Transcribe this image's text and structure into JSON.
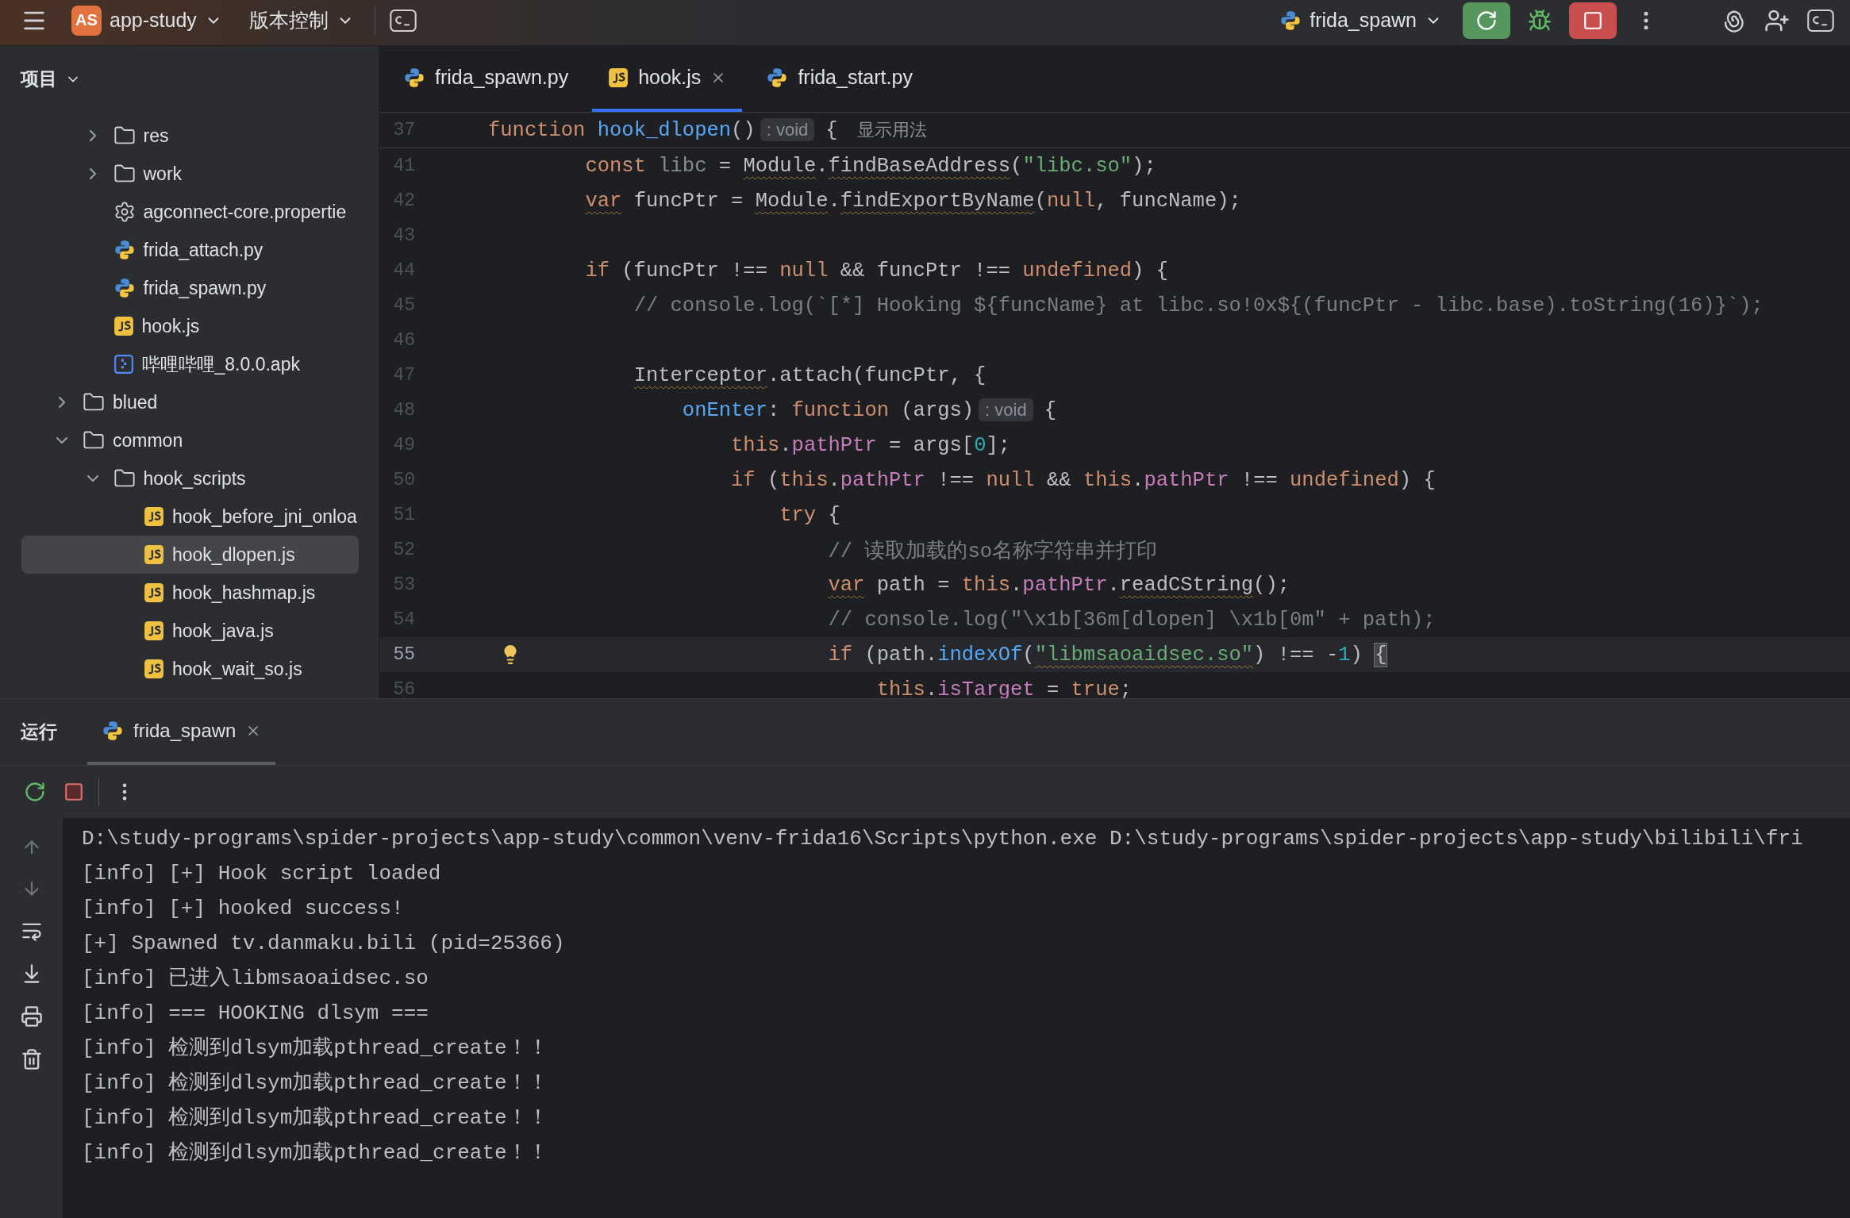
{
  "toolbar": {
    "project_badge": "AS",
    "project": "app-study",
    "vcs": "版本控制",
    "run_config": "frida_spawn"
  },
  "sidebar": {
    "title": "项目",
    "tree": [
      {
        "children": [
          {
            "label": "res",
            "kind": "folder",
            "expanded": false,
            "selected": false
          },
          {
            "label": "work",
            "kind": "folder",
            "expanded": false,
            "selected": false
          },
          {
            "label": "agconnect-core.propertie",
            "kind": "settings",
            "selected": false
          },
          {
            "label": "frida_attach.py",
            "kind": "python",
            "selected": false
          },
          {
            "label": "frida_spawn.py",
            "kind": "python",
            "selected": false
          },
          {
            "label": "hook.js",
            "kind": "js",
            "selected": false
          },
          {
            "label": "哔哩哔哩_8.0.0.apk",
            "kind": "apk",
            "selected": false
          }
        ]
      },
      {
        "label": "blued",
        "kind": "folder",
        "expanded": false,
        "selected": false
      },
      {
        "label": "common",
        "kind": "folder",
        "expanded": true,
        "selected": false,
        "children": [
          {
            "label": "hook_scripts",
            "kind": "folder",
            "expanded": true,
            "selected": false,
            "children": [
              {
                "label": "hook_before_jni_onloa",
                "kind": "js",
                "selected": false
              },
              {
                "label": "hook_dlopen.js",
                "kind": "js",
                "selected": true
              },
              {
                "label": "hook_hashmap.js",
                "kind": "js",
                "selected": false
              },
              {
                "label": "hook_java.js",
                "kind": "js",
                "selected": false
              },
              {
                "label": "hook_wait_so.js",
                "kind": "js",
                "selected": false
              }
            ]
          }
        ]
      }
    ]
  },
  "editor_tabs": [
    {
      "label": "frida_spawn.py",
      "kind": "python",
      "selected": false
    },
    {
      "label": "hook.js",
      "kind": "js",
      "selected": true
    },
    {
      "label": "frida_start.py",
      "kind": "python",
      "selected": false
    }
  ],
  "sticky_line": {
    "n": "37",
    "tokens": [
      {
        "text": "function ",
        "kind": "kw"
      },
      {
        "text": "hook_dlopen",
        "kind": "fn"
      },
      {
        "text": "()",
        "kind": "plain"
      },
      {
        "text": ": void",
        "kind": "hint"
      },
      {
        "text": "{",
        "kind": "plain"
      },
      {
        "text": "显示用法",
        "kind": "usage"
      }
    ]
  },
  "code": [
    {
      "n": "41",
      "current": false,
      "tokens": [
        {
          "text": "        const ",
          "kind": "kw"
        },
        {
          "text": "libc",
          "kind": "dim"
        },
        {
          "text": " = ",
          "kind": "plain"
        },
        {
          "text": "Module",
          "kind": "warn"
        },
        {
          "text": ".",
          "kind": "plain"
        },
        {
          "text": "findBaseAddress",
          "kind": "warn"
        },
        {
          "text": "(",
          "kind": "plain"
        },
        {
          "text": "\"libc.so\"",
          "kind": "str"
        },
        {
          "text": ");",
          "kind": "plain"
        }
      ]
    },
    {
      "n": "42",
      "current": false,
      "tokens": [
        {
          "text": "        var",
          "kind": "kwwarn"
        },
        {
          "text": " funcPtr = ",
          "kind": "plain"
        },
        {
          "text": "Module",
          "kind": "warn"
        },
        {
          "text": ".",
          "kind": "plain"
        },
        {
          "text": "findExportByName",
          "kind": "warn"
        },
        {
          "text": "(",
          "kind": "plain"
        },
        {
          "text": "null",
          "kind": "kw"
        },
        {
          "text": ", funcName);",
          "kind": "plain"
        }
      ]
    },
    {
      "n": "43",
      "current": false
    },
    {
      "n": "44",
      "current": false,
      "tokens": [
        {
          "text": "        if",
          "kind": "kw"
        },
        {
          "text": " (funcPtr !== ",
          "kind": "plain"
        },
        {
          "text": "null",
          "kind": "kw"
        },
        {
          "text": " && funcPtr !== ",
          "kind": "plain"
        },
        {
          "text": "undefined",
          "kind": "kw"
        },
        {
          "text": ") {",
          "kind": "plain"
        }
      ]
    },
    {
      "n": "45",
      "current": false,
      "tokens": [
        {
          "text": "            // console.log(`[*] Hooking ${funcName} at libc.so!0x${(funcPtr - libc.base).toString(16)}`);",
          "kind": "cm"
        }
      ]
    },
    {
      "n": "46",
      "current": false
    },
    {
      "n": "47",
      "current": false,
      "tokens": [
        {
          "text": "            Interceptor",
          "kind": "warn"
        },
        {
          "text": ".attach(funcPtr, {",
          "kind": "plain"
        }
      ]
    },
    {
      "n": "48",
      "current": false,
      "tokens": [
        {
          "text": "                onEnter",
          "kind": "fn"
        },
        {
          "text": ": ",
          "kind": "plain"
        },
        {
          "text": "function",
          "kind": "kw"
        },
        {
          "text": " (args)",
          "kind": "plain"
        },
        {
          "text": ": void",
          "kind": "hint"
        },
        {
          "text": "{",
          "kind": "plain"
        }
      ]
    },
    {
      "n": "49",
      "current": false,
      "tokens": [
        {
          "text": "                    this",
          "kind": "kw"
        },
        {
          "text": ".",
          "kind": "plain"
        },
        {
          "text": "pathPtr",
          "kind": "field"
        },
        {
          "text": " = args[",
          "kind": "plain"
        },
        {
          "text": "0",
          "kind": "num"
        },
        {
          "text": "];",
          "kind": "plain"
        }
      ]
    },
    {
      "n": "50",
      "current": false,
      "tokens": [
        {
          "text": "                    if",
          "kind": "kw"
        },
        {
          "text": " (",
          "kind": "plain"
        },
        {
          "text": "this",
          "kind": "kw"
        },
        {
          "text": ".",
          "kind": "plain"
        },
        {
          "text": "pathPtr",
          "kind": "field"
        },
        {
          "text": " !== ",
          "kind": "plain"
        },
        {
          "text": "null",
          "kind": "kw"
        },
        {
          "text": " && ",
          "kind": "plain"
        },
        {
          "text": "this",
          "kind": "kw"
        },
        {
          "text": ".",
          "kind": "plain"
        },
        {
          "text": "pathPtr",
          "kind": "field"
        },
        {
          "text": " !== ",
          "kind": "plain"
        },
        {
          "text": "undefined",
          "kind": "kw"
        },
        {
          "text": ") {",
          "kind": "plain"
        }
      ]
    },
    {
      "n": "51",
      "current": false,
      "tokens": [
        {
          "text": "                        try",
          "kind": "kw"
        },
        {
          "text": " {",
          "kind": "plain"
        }
      ]
    },
    {
      "n": "52",
      "current": false,
      "tokens": [
        {
          "text": "                            // 读取加载的so名称字符串并打印",
          "kind": "cm"
        }
      ]
    },
    {
      "n": "53",
      "current": false,
      "tokens": [
        {
          "text": "                            var",
          "kind": "kwwarn"
        },
        {
          "text": " path = ",
          "kind": "plain"
        },
        {
          "text": "this",
          "kind": "kw"
        },
        {
          "text": ".",
          "kind": "plain"
        },
        {
          "text": "pathPtr",
          "kind": "field"
        },
        {
          "text": ".",
          "kind": "plain"
        },
        {
          "text": "readCString",
          "kind": "warn"
        },
        {
          "text": "();",
          "kind": "plain"
        }
      ]
    },
    {
      "n": "54",
      "current": false,
      "tokens": [
        {
          "text": "                            // console.log(\"\\x1b[36m[dlopen] \\x1b[0m\" + path);",
          "kind": "cm"
        }
      ]
    },
    {
      "n": "55",
      "current": true,
      "tokens": [
        {
          "text": "                            if",
          "kind": "kw"
        },
        {
          "text": " (path.",
          "kind": "plain"
        },
        {
          "text": "indexOf",
          "kind": "fn"
        },
        {
          "text": "(",
          "kind": "plain"
        },
        {
          "text": "\"libmsaoaidsec.so\"",
          "kind": "strwarn"
        },
        {
          "text": ") !== -",
          "kind": "plain"
        },
        {
          "text": "1",
          "kind": "num"
        },
        {
          "text": ") ",
          "kind": "plain"
        },
        {
          "text": "{",
          "kind": "match"
        }
      ]
    },
    {
      "n": "56",
      "current": false,
      "tokens": [
        {
          "text": "                                this",
          "kind": "kw"
        },
        {
          "text": ".",
          "kind": "plain"
        },
        {
          "text": "isTarget",
          "kind": "field"
        },
        {
          "text": " = ",
          "kind": "plain"
        },
        {
          "text": "true",
          "kind": "kw"
        },
        {
          "text": ";",
          "kind": "plain"
        }
      ]
    }
  ],
  "run_panel": {
    "title": "运行",
    "tabs": [
      {
        "label": "frida_spawn",
        "selected": true
      }
    ],
    "console": [
      "D:\\study-programs\\spider-projects\\app-study\\common\\venv-frida16\\Scripts\\python.exe D:\\study-programs\\spider-projects\\app-study\\bilibili\\fri",
      "[info] [+] Hook script loaded",
      "[info] [+] hooked success!",
      "[+] Spawned tv.danmaku.bili (pid=25366)",
      "[info] 已进入libmsaoaidsec.so",
      "[info] === HOOKING dlsym ===",
      "[info] 检测到dlsym加载pthread_create！！",
      "[info] 检测到dlsym加载pthread_create！！",
      "[info] 检测到dlsym加载pthread_create！！",
      "[info] 检测到dlsym加载pthread_create！！"
    ]
  }
}
